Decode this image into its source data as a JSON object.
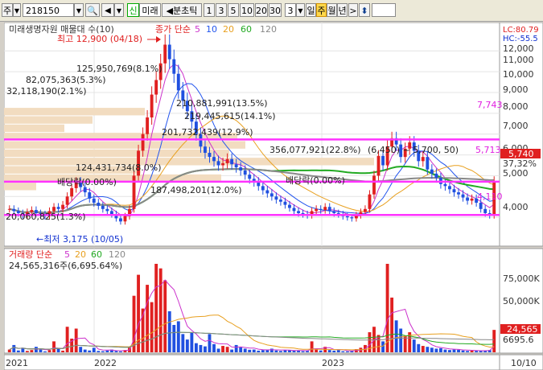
{
  "toolbar": {
    "market": "주",
    "code": "218150",
    "search_icon": "magnifier-icon",
    "speaker_icon": "speaker-icon",
    "new_label": "신",
    "broker_label": "미래",
    "split_label": "◀분초틱",
    "intervals": [
      "1",
      "3",
      "5",
      "10",
      "20",
      "30"
    ],
    "interval_value": "3",
    "day": "일",
    "week": "주",
    "month": "월",
    "year": "년",
    "next": ">",
    "updown_icon": "updown-arrow-icon"
  },
  "price_panel": {
    "legend_label": "미래생명자원 매물대 수(10)",
    "ma_label": "종가 단순",
    "ma_periods": [
      "5",
      "10",
      "20",
      "60",
      "120"
    ],
    "lc_label": "LC:80.79",
    "hc_label": "HC:-55.5",
    "high_label": "최고 12,900 (04/18)",
    "low_label": "←최저 3,175 (10/05)",
    "volume_profile_labels": [
      "125,950,769(8.1%)",
      "82,075,363(5.3%)",
      "32,118,190(2.1%)",
      "210,881,991(13.5%)",
      "219,445,615(14.1%)",
      "201,732,439(12.9%)",
      "356,077,921(22.8%)",
      "124,431,734(8.0%)",
      "187,498,201(12.0%)",
      "20,060,825(1.3%)",
      "(6,450) ~ 5,700, 50)",
      "5,713"
    ],
    "event_labels": [
      "배당락(0.00%)",
      "배당락(0.00%)"
    ],
    "right_labels": {
      "line_upper": "7,743",
      "current": "5,740",
      "volume_ratio": "37,32%",
      "low_marker": "4,110"
    },
    "y_ticks": [
      "12,000",
      "11,000",
      "10,000",
      "9,000",
      "8,000",
      "7,000",
      "6,000",
      "5,000",
      "4,000"
    ]
  },
  "volume_panel": {
    "legend_label": "거래량 단순",
    "ma_periods": [
      "5",
      "20",
      "60",
      "120"
    ],
    "value_label": "24,565,316주(6,695.64%)",
    "y_ticks": [
      "75,000K",
      "50,000K"
    ],
    "current_label": "24,565",
    "ratio_label": "6695.6"
  },
  "x_axis": {
    "ticks": [
      "2021",
      "2022",
      "2023"
    ],
    "date_label": "10/10"
  },
  "colors": {
    "up": "#e02020",
    "down": "#2050e0",
    "ma5": "#cc33cc",
    "ma10": "#2255ee",
    "ma20": "#e8a020",
    "ma60": "#22aa22",
    "ma120": "#888888",
    "band": "#ff33ff",
    "profile": "#f2dcc0"
  },
  "chart_data": {
    "type": "candlestick",
    "price_range": [
      3000,
      12900
    ],
    "volume_range": [
      0,
      97000
    ],
    "horizontal_levels": [
      7743,
      5713,
      4110
    ],
    "period_labels": [
      "2021",
      "2022",
      "2023"
    ],
    "weekly_close": [
      4400,
      4300,
      4200,
      4100,
      4250,
      4350,
      4200,
      4150,
      4050,
      4300,
      4500,
      4400,
      4600,
      5000,
      5400,
      5700,
      5450,
      5200,
      4900,
      4700,
      4550,
      4400,
      4300,
      4150,
      3950,
      3800,
      4050,
      4400,
      6000,
      7200,
      8000,
      8800,
      9900,
      10600,
      11400,
      12300,
      11600,
      10900,
      10100,
      9600,
      9100,
      8600,
      8000,
      7400,
      7100,
      6900,
      6700,
      6500,
      6600,
      6800,
      6550,
      6400,
      6250,
      6050,
      5850,
      5700,
      5500,
      5300,
      5150,
      5000,
      4850,
      4750,
      4600,
      4450,
      4300,
      4200,
      4150,
      4100,
      4300,
      4400,
      4350,
      4500,
      4300,
      4200,
      4150,
      4050,
      4000,
      3950,
      4100,
      4250,
      4400,
      5100,
      6000,
      6950,
      6500,
      7400,
      7800,
      7500,
      6900,
      7300,
      7600,
      7200,
      6700,
      6900,
      6300,
      6100,
      5900,
      5600,
      5500,
      5350,
      5200,
      5100,
      4950,
      4800,
      4900,
      4700,
      4400,
      4200,
      4100,
      5740
    ],
    "weekly_volume": [
      3000,
      8000,
      2000,
      5000,
      1500,
      2500,
      6000,
      3000,
      1000,
      2500,
      12000,
      4000,
      1800,
      28000,
      15000,
      26000,
      6000,
      3000,
      2000,
      5000,
      1500,
      1200,
      2000,
      3000,
      1500,
      1000,
      2500,
      5000,
      62000,
      85000,
      48000,
      74000,
      55000,
      97000,
      92000,
      79000,
      45000,
      30000,
      34000,
      20000,
      14000,
      22000,
      10000,
      8000,
      6500,
      20000,
      9000,
      4000,
      7000,
      6000,
      3000,
      8000,
      5500,
      4000,
      2800,
      3000,
      1800,
      2500,
      3000,
      4000,
      2000,
      1500,
      2500,
      2200,
      1800,
      2000,
      1200,
      1500,
      12000,
      3000,
      2000,
      6000,
      2500,
      1800,
      2500,
      1200,
      1000,
      1500,
      3500,
      5000,
      8000,
      22000,
      28000,
      19000,
      12000,
      97000,
      60000,
      35000,
      26000,
      18000,
      22000,
      14000,
      9000,
      7000,
      6000,
      5000,
      4000,
      4500,
      3000,
      2500,
      3000,
      2800,
      2000,
      1500,
      1800,
      1600,
      2000,
      1800,
      2500,
      24565
    ]
  }
}
